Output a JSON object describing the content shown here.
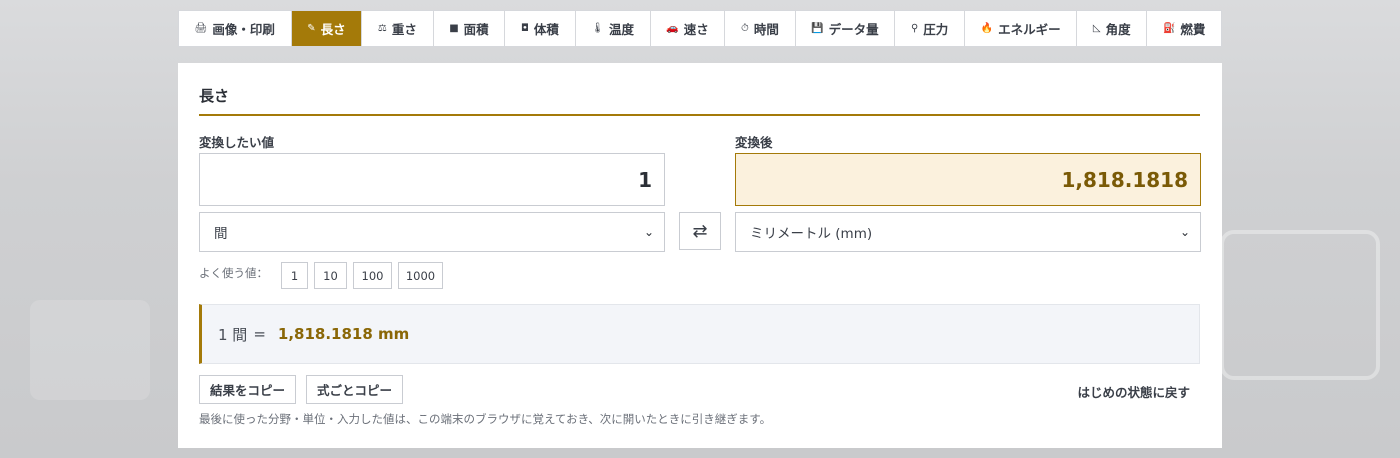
{
  "tabs": [
    {
      "icon": "🖨",
      "icon_name": "printer-icon",
      "label": "画像・印刷",
      "active": false
    },
    {
      "icon": "✎",
      "icon_name": "ruler-icon",
      "label": "長さ",
      "active": true
    },
    {
      "icon": "⚖",
      "icon_name": "scale-icon",
      "label": "重さ",
      "active": false
    },
    {
      "icon": "■",
      "icon_name": "area-icon",
      "label": "面積",
      "active": false
    },
    {
      "icon": "◘",
      "icon_name": "cup-icon",
      "label": "体積",
      "active": false
    },
    {
      "icon": "🌡",
      "icon_name": "thermometer-icon",
      "label": "温度",
      "active": false
    },
    {
      "icon": "🚗",
      "icon_name": "car-icon",
      "label": "速さ",
      "active": false
    },
    {
      "icon": "⏱",
      "icon_name": "stopwatch-icon",
      "label": "時間",
      "active": false
    },
    {
      "icon": "💾",
      "icon_name": "floppy-icon",
      "label": "データ量",
      "active": false
    },
    {
      "icon": "⚲",
      "icon_name": "gauge-icon",
      "label": "圧力",
      "active": false
    },
    {
      "icon": "🔥",
      "icon_name": "fire-icon",
      "label": "エネルギー",
      "active": false
    },
    {
      "icon": "◺",
      "icon_name": "angle-icon",
      "label": "角度",
      "active": false
    },
    {
      "icon": "⛽",
      "icon_name": "fuel-icon",
      "label": "燃費",
      "active": false
    }
  ],
  "panel": {
    "title": "長さ",
    "input_label": "変換したい値",
    "input_value": "1",
    "result_label": "変換後",
    "result_value": "1,818.1818",
    "from_unit": "間",
    "to_unit": "ミリメートル (mm)",
    "swap_icon": "⇄",
    "quick_label": "よく使う値：",
    "quick_values": [
      "1",
      "10",
      "100",
      "1000"
    ],
    "formula": {
      "lhs": "1 間",
      "eq": "=",
      "rhs": "1,818.1818 mm"
    },
    "copy_result": "結果をコピー",
    "copy_formula": "式ごとコピー",
    "reset": "はじめの状態に戻す",
    "note": "最後に使った分野・単位・入力した値は、この端末のブラウザに覚えておき、次に開いたときに引き継ぎます。"
  },
  "colors": {
    "accent": "#a47a09",
    "result_bg": "#fbf1dd"
  }
}
